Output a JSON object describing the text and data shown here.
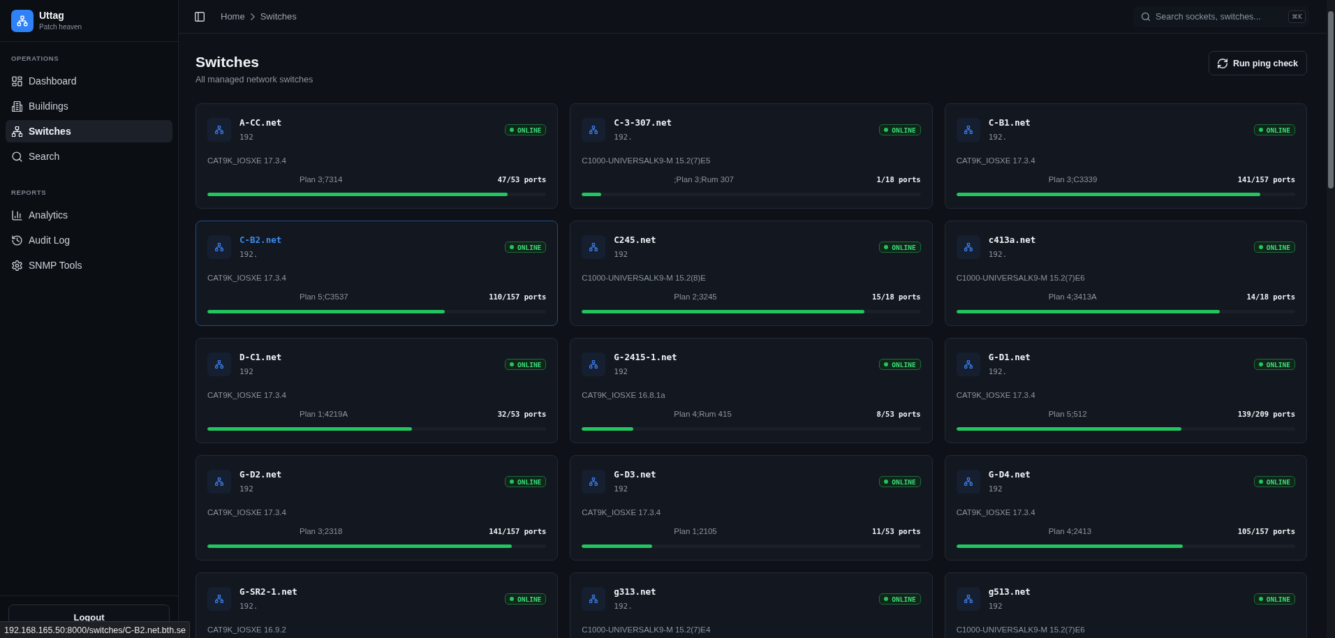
{
  "sidebar": {
    "brand": {
      "name": "Uttag",
      "tagline": "Patch heaven"
    },
    "sections": [
      {
        "label": "OPERATIONS",
        "items": [
          {
            "label": "Dashboard",
            "selected": false
          },
          {
            "label": "Buildings",
            "selected": false
          },
          {
            "label": "Switches",
            "selected": true
          },
          {
            "label": "Search",
            "selected": false
          }
        ]
      },
      {
        "label": "REPORTS",
        "items": [
          {
            "label": "Analytics",
            "selected": false
          },
          {
            "label": "Audit Log",
            "selected": false
          },
          {
            "label": "SNMP Tools",
            "selected": false
          }
        ]
      }
    ],
    "logout": "Logout"
  },
  "header": {
    "breadcrumb": [
      "Home",
      "Switches"
    ],
    "search": {
      "placeholder": "Search sockets, switches...",
      "shortcut": "⌘K"
    }
  },
  "page": {
    "title": "Switches",
    "subtitle": "All managed network switches",
    "action": "Run ping check"
  },
  "switches": [
    {
      "name": "A-CC.net",
      "ip": "192",
      "status": "ONLINE",
      "online": true,
      "model": "CAT9K_IOSXE 17.3.4",
      "location": "Plan 3;7314",
      "ports": "47/53 ports",
      "level": 0.887,
      "hovered": false
    },
    {
      "name": "C-3-307.net",
      "ip": "192.",
      "status": "ONLINE",
      "online": true,
      "model": "C1000-UNIVERSALK9-M 15.2(7)E5",
      "location": ";Plan 3;Rum 307",
      "ports": "1/18 ports",
      "level": 0.056,
      "hovered": false
    },
    {
      "name": "C-B1.net",
      "ip": "192.",
      "status": "ONLINE",
      "online": true,
      "model": "CAT9K_IOSXE 17.3.4",
      "location": "Plan 3;C3339",
      "ports": "141/157 ports",
      "level": 0.898,
      "hovered": false
    },
    {
      "name": "C-B2.net",
      "ip": "192.",
      "status": "ONLINE",
      "online": true,
      "model": "CAT9K_IOSXE 17.3.4",
      "location": "Plan 5;C3537",
      "ports": "110/157 ports",
      "level": 0.701,
      "hovered": true
    },
    {
      "name": "C245.net",
      "ip": "192",
      "status": "ONLINE",
      "online": true,
      "model": "C1000-UNIVERSALK9-M 15.2(8)E",
      "location": "Plan 2;3245",
      "ports": "15/18 ports",
      "level": 0.833,
      "hovered": false
    },
    {
      "name": "c413a.net",
      "ip": "192.",
      "status": "ONLINE",
      "online": true,
      "model": "C1000-UNIVERSALK9-M 15.2(7)E6",
      "location": "Plan 4;3413A",
      "ports": "14/18 ports",
      "level": 0.778,
      "hovered": false
    },
    {
      "name": "D-C1.net",
      "ip": "192",
      "status": "ONLINE",
      "online": true,
      "model": "CAT9K_IOSXE 17.3.4",
      "location": "Plan 1;4219A",
      "ports": "32/53 ports",
      "level": 0.604,
      "hovered": false
    },
    {
      "name": "G-2415-1.net",
      "ip": "192",
      "status": "ONLINE",
      "online": true,
      "model": "CAT9K_IOSXE 16.8.1a",
      "location": "Plan 4;Rum 415",
      "ports": "8/53 ports",
      "level": 0.151,
      "hovered": false
    },
    {
      "name": "G-D1.net",
      "ip": "192.",
      "status": "ONLINE",
      "online": true,
      "model": "CAT9K_IOSXE 17.3.4",
      "location": "Plan 5;512",
      "ports": "139/209 ports",
      "level": 0.665,
      "hovered": false
    },
    {
      "name": "G-D2.net",
      "ip": "192",
      "status": "ONLINE",
      "online": true,
      "model": "CAT9K_IOSXE 17.3.4",
      "location": "Plan 3;2318",
      "ports": "141/157 ports",
      "level": 0.898,
      "hovered": false
    },
    {
      "name": "G-D3.net",
      "ip": "192",
      "status": "ONLINE",
      "online": true,
      "model": "CAT9K_IOSXE 17.3.4",
      "location": "Plan 1;2105",
      "ports": "11/53 ports",
      "level": 0.208,
      "hovered": false
    },
    {
      "name": "G-D4.net",
      "ip": "192",
      "status": "ONLINE",
      "online": true,
      "model": "CAT9K_IOSXE 17.3.4",
      "location": "Plan 4;2413",
      "ports": "105/157 ports",
      "level": 0.669,
      "hovered": false
    },
    {
      "name": "G-SR2-1.net",
      "ip": "192.",
      "status": "ONLINE",
      "online": true,
      "model": "CAT9K_IOSXE 16.9.2",
      "hovered": false
    },
    {
      "name": "g313.net",
      "ip": "192.",
      "status": "ONLINE",
      "online": true,
      "model": "C1000-UNIVERSALK9-M 15.2(7)E4",
      "hovered": false
    },
    {
      "name": "g513.net",
      "ip": "192",
      "status": "ONLINE",
      "online": true,
      "model": "C1000-UNIVERSALK9-M 15.2(7)E6",
      "hovered": false
    }
  ],
  "status_bar": {
    "url": "192.168.165.50:8000/switches/C-B2.net.bth.se"
  }
}
